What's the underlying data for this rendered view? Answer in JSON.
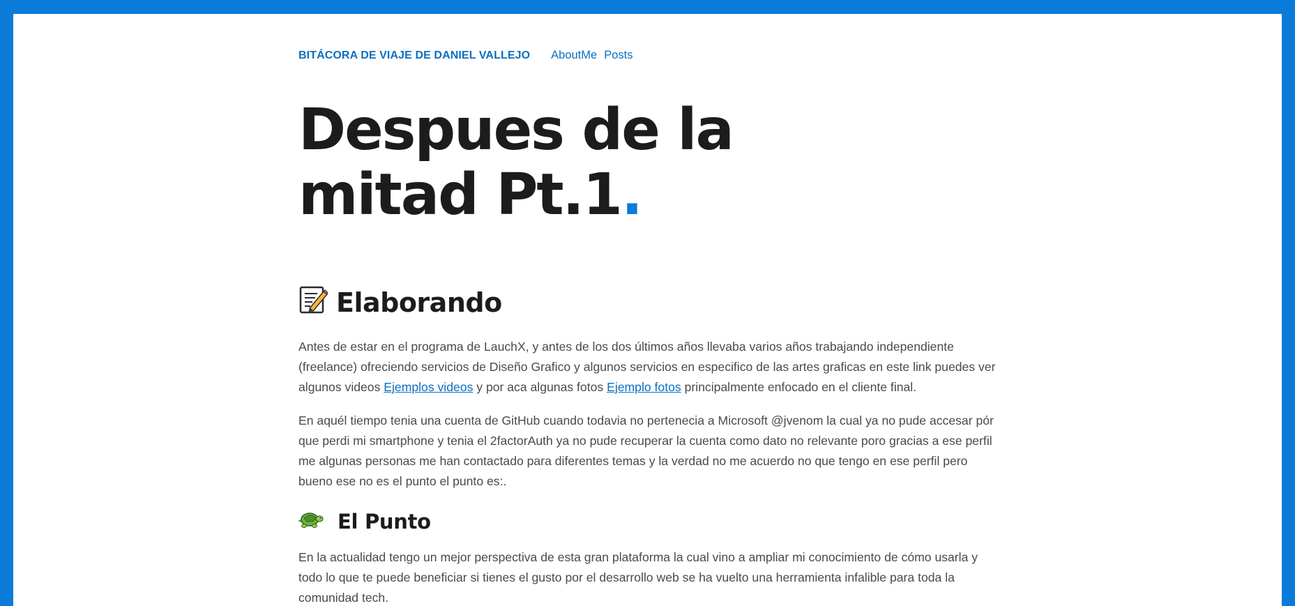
{
  "header": {
    "site_title": "BITÁCORA DE VIAJE DE DANIEL VALLEJO",
    "nav": [
      "AboutMe",
      "Posts"
    ]
  },
  "post": {
    "title_line1": "Despues de la",
    "title_line2": "mitad Pt.1",
    "title_dot": ".",
    "section1": {
      "icon": "memo-icon",
      "heading": "Elaborando",
      "p1": {
        "a": "Antes de estar en el programa de LauchX, y antes de los dos últimos años llevaba varios años trabajando independiente (freelance) ofreciendo servicios de Diseño Grafico y algunos servicios en especifico de las artes graficas en este link puedes ver algunos videos ",
        "link1": "Ejemplos videos",
        "b": " y por aca algunas fotos ",
        "link2": "Ejemplo fotos",
        "c": " principalmente enfocado en el cliente final."
      },
      "p2": "En aquél tiempo tenia una cuenta de GitHub cuando todavia no pertenecia a Microsoft @jvenom la cual ya no pude accesar pór que perdi mi smartphone y tenia el 2factorAuth ya no pude recuperar la cuenta como dato no relevante poro gracias a ese perfil me algunas personas me han contactado para diferentes temas y la verdad no me acuerdo no que tengo en ese perfil pero bueno ese no es el punto el punto es:."
    },
    "section2": {
      "icon": "turtle-icon",
      "heading": "El Punto",
      "p1": "En la actualidad tengo un mejor perspectiva de esta gran plataforma la cual vino a ampliar mi conocimiento de cómo usarla y todo lo que te puede beneficiar si tienes el gusto por el desarrollo web se ha vuelto una herramienta infalible para toda la comunidad tech."
    }
  },
  "colors": {
    "accent": "#0a7bd8",
    "link": "#0a6fc2",
    "heading": "#1c1c1c",
    "body_text": "#4a4a4a"
  }
}
